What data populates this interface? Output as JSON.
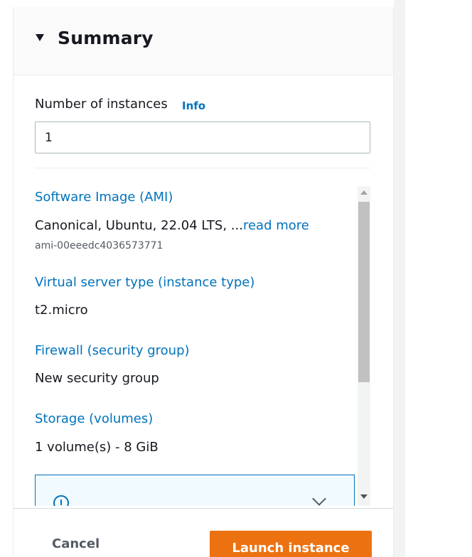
{
  "summary": {
    "title": "Summary",
    "instances_label": "Number of instances",
    "info_label": "Info",
    "instances_value": "1",
    "sections": {
      "ami_label": "Software Image (AMI)",
      "ami_value": "Canonical, Ubuntu, 22.04 LTS, ...",
      "read_more": "read more",
      "ami_id": "ami-00eeedc4036573771",
      "instance_type_label": "Virtual server type (instance type)",
      "instance_type_value": "t2.micro",
      "firewall_label": "Firewall (security group)",
      "firewall_value": "New security group",
      "storage_label": "Storage (volumes)",
      "storage_value": "1 volume(s) - 8 GiB"
    }
  },
  "footer": {
    "cancel_label": "Cancel",
    "launch_label": "Launch instance"
  },
  "colors": {
    "link": "#0073bb",
    "primary_button": "#ec7211",
    "header_bg": "#fafafa"
  }
}
